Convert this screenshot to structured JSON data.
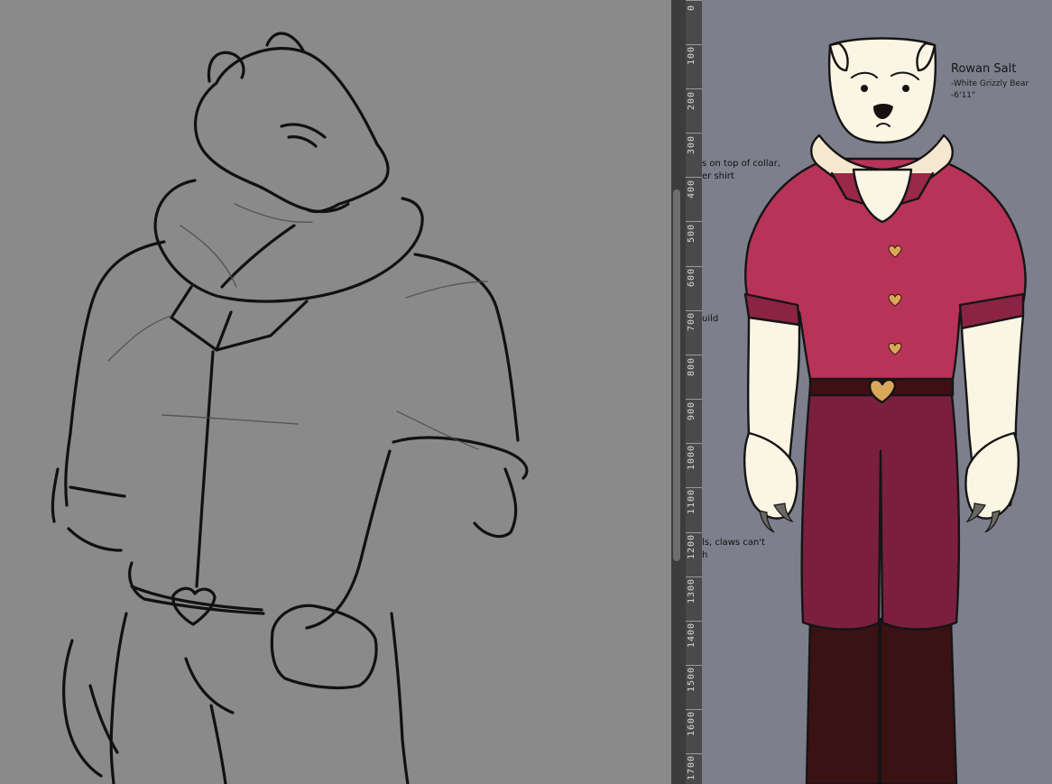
{
  "ruler": {
    "labels": [
      "0",
      "100",
      "200",
      "300",
      "400",
      "500",
      "600",
      "700",
      "800",
      "900",
      "1000",
      "1100",
      "1200",
      "1300",
      "1400",
      "1500",
      "1600",
      "1700"
    ]
  },
  "reference_sheet": {
    "character_name": "Rowan Salt",
    "species": "-White Grizzly Bear",
    "height": "-6'11\"",
    "notes": [
      "s on top of collar,",
      "er shirt",
      "uild",
      "ls, claws can't",
      "h"
    ]
  },
  "colors": {
    "canvas_left": "#8a8a8a",
    "canvas_right": "#7d7f8c",
    "shirt": "#b83358",
    "pants": "#7a1f3e",
    "fur": "#fbf5e4",
    "belt_buckle": "#d8a75a"
  }
}
